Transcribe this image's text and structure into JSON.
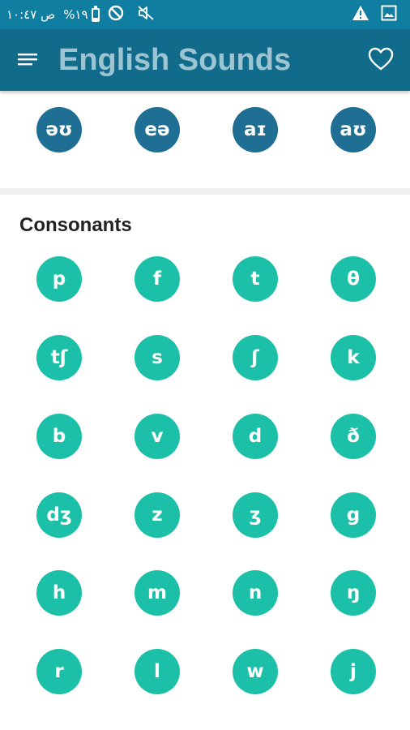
{
  "status_bar": {
    "time": "ص ١٠:٤٧",
    "battery": "%١٩",
    "battery_level": 0.19,
    "left_icons": [
      "no-entry-icon",
      "mute-icon"
    ],
    "right_icons": [
      "warning-icon",
      "image-icon"
    ]
  },
  "app_bar": {
    "title": "English Sounds",
    "title_color": "#9cc4d3",
    "background": "#116b8a",
    "menu_icon": "menu-icon",
    "favorite_icon": "heart-outline-icon"
  },
  "diphthongs": {
    "color": "#1f6f94",
    "sounds": [
      "əʊ",
      "eə",
      "aɪ",
      "aʊ"
    ]
  },
  "consonants": {
    "title": "Consonants",
    "color": "#1cc0a8",
    "rows": [
      [
        "p",
        "f",
        "t",
        "θ"
      ],
      [
        "tʃ",
        "s",
        "ʃ",
        "k"
      ],
      [
        "b",
        "v",
        "d",
        "ð"
      ],
      [
        "dʒ",
        "z",
        "ʒ",
        "g"
      ],
      [
        "h",
        "m",
        "n",
        "ŋ"
      ],
      [
        "r",
        "l",
        "w",
        "j"
      ]
    ]
  }
}
